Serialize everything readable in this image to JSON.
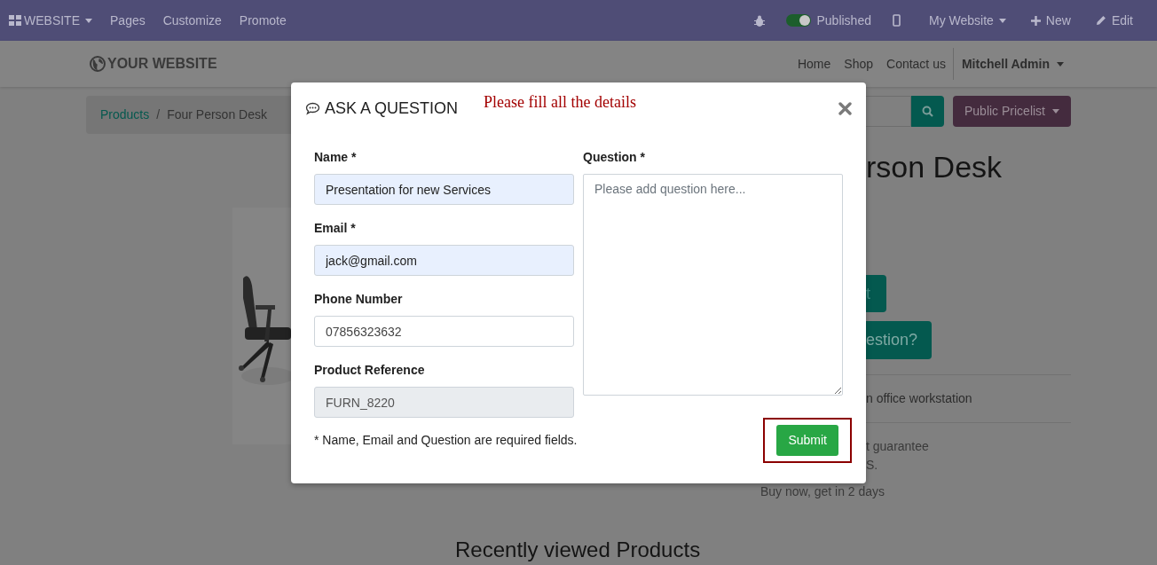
{
  "topbar": {
    "app_menu": "WEBSITE",
    "menu_items": [
      "Pages",
      "Customize",
      "Promote"
    ],
    "published": {
      "label": "Published",
      "on": true
    },
    "website_menu": "My Website",
    "new_button": "New",
    "edit_button": "Edit"
  },
  "header": {
    "logo": "YOUR WEBSITE",
    "nav": [
      "Home",
      "Shop",
      "Contact us"
    ],
    "user": "Mitchell Admin"
  },
  "breadcrumb_separator": "/",
  "breadcrumb": [
    {
      "label": "Products",
      "kind": "link"
    },
    {
      "label": "Four Person Desk",
      "kind": "current"
    }
  ],
  "pricelist": "Public Pricelist",
  "product": {
    "title": "rson Desk",
    "cart_button": "t",
    "question_button": "estion?",
    "description": "n office workstation",
    "notes": [
      "t guarantee",
      "S.",
      "Buy now, get in 2 days"
    ]
  },
  "recently_viewed_title": "Recently viewed Products",
  "modal": {
    "title": "ASK A QUESTION",
    "notice": "Please fill all the details",
    "fields": [
      {
        "label": "Name *",
        "value": "Presentation for new Services",
        "kind": "autofilled"
      },
      {
        "label": "Email *",
        "value": "jack@gmail.com",
        "kind": "autofilled"
      },
      {
        "label": "Phone Number",
        "value": "07856323632",
        "kind": "plain"
      },
      {
        "label": "Product Reference",
        "value": "FURN_8220",
        "kind": "readonly"
      }
    ],
    "question": {
      "label": "Question *",
      "placeholder": "Please add question here..."
    },
    "footnote": "* Name, Email and Question are required fields.",
    "submit": {
      "label": "Submit",
      "highlighted": true
    }
  }
}
